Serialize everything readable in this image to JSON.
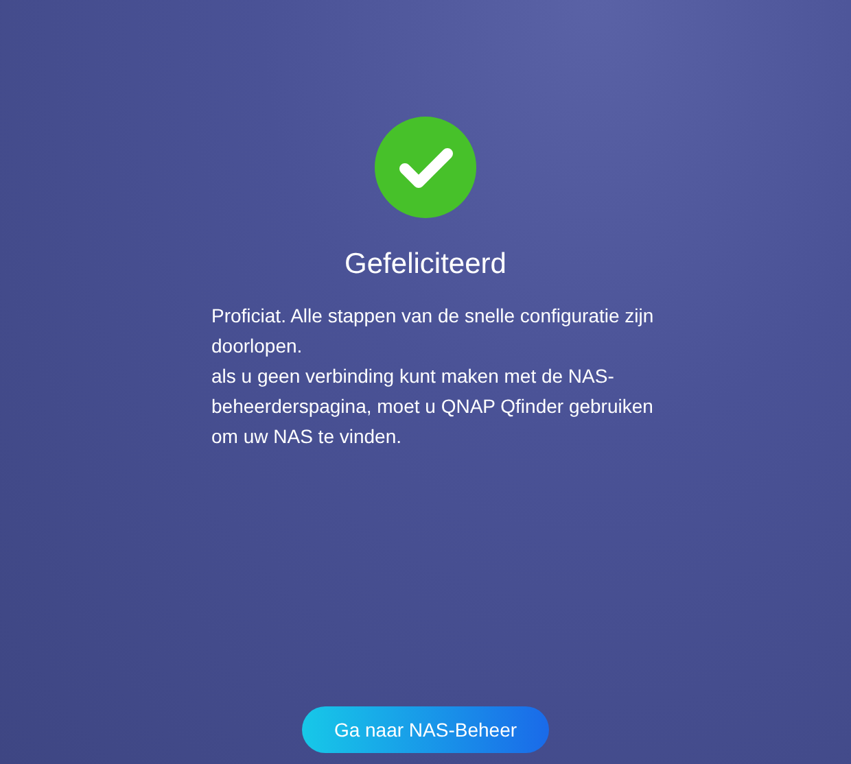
{
  "title": "Gefeliciteerd",
  "messages": [
    "Proficiat. Alle stappen van de snelle configuratie zijn doorlopen.",
    "als u geen verbinding kunt maken met de NAS-beheerderspagina, moet u QNAP Qfinder gebruiken om uw NAS te vinden."
  ],
  "button": "Ga naar NAS-Beheer"
}
